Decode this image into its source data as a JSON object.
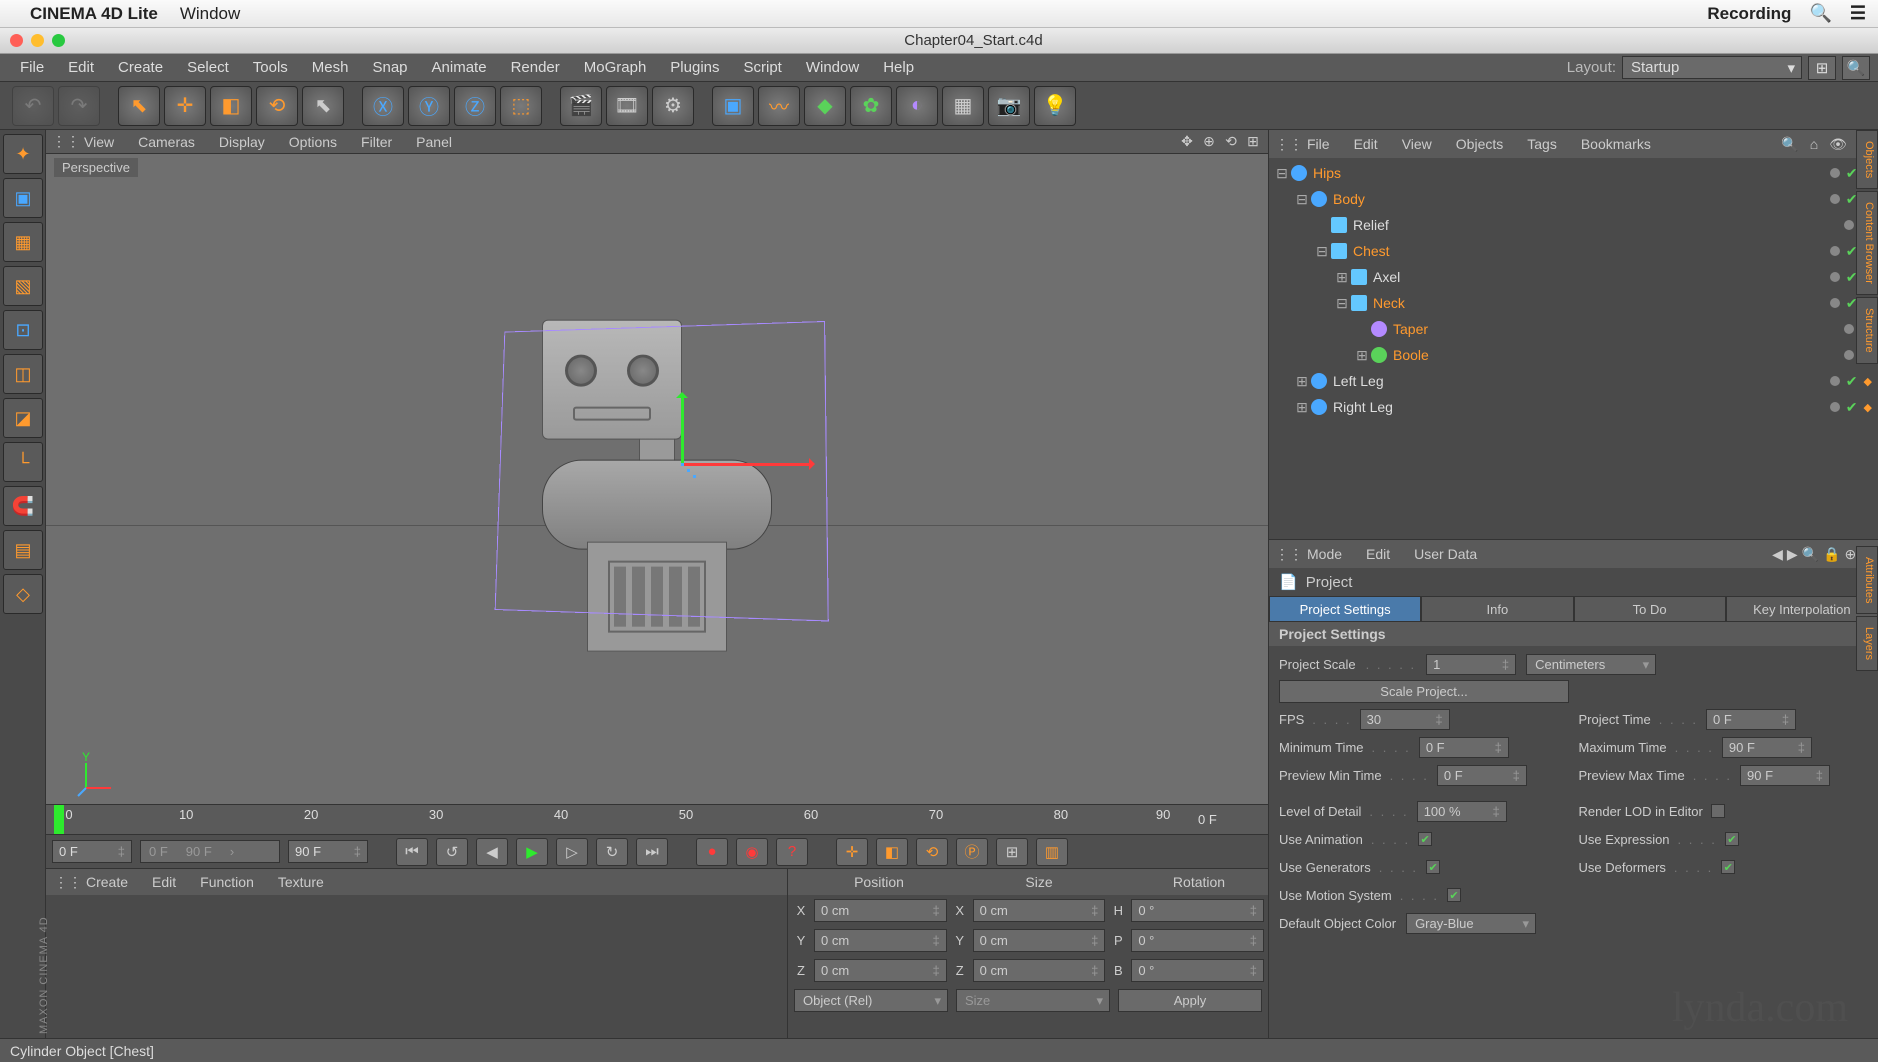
{
  "mac_menubar": {
    "app": "CINEMA 4D Lite",
    "items": [
      "Window"
    ],
    "right_status": "Recording"
  },
  "window": {
    "title": "Chapter04_Start.c4d"
  },
  "main_menu": {
    "items": [
      "File",
      "Edit",
      "Create",
      "Select",
      "Tools",
      "Mesh",
      "Snap",
      "Animate",
      "Render",
      "MoGraph",
      "Plugins",
      "Script",
      "Window",
      "Help"
    ],
    "layout_label": "Layout:",
    "layout_value": "Startup"
  },
  "viewport": {
    "menu": [
      "View",
      "Cameras",
      "Display",
      "Options",
      "Filter",
      "Panel"
    ],
    "label": "Perspective",
    "axis_y": "Y"
  },
  "object_manager": {
    "menu": [
      "File",
      "Edit",
      "View",
      "Objects",
      "Tags",
      "Bookmarks"
    ],
    "tree": [
      {
        "depth": 0,
        "expand": "⊟",
        "icon": "null",
        "name": "Hips",
        "hl": true,
        "tags": 2
      },
      {
        "depth": 1,
        "expand": "⊟",
        "icon": "null",
        "name": "Body",
        "hl": true,
        "tags": 2
      },
      {
        "depth": 2,
        "expand": "",
        "icon": "cube",
        "name": "Relief",
        "hl": false,
        "tags": 1
      },
      {
        "depth": 2,
        "expand": "⊟",
        "icon": "cyl",
        "name": "Chest",
        "hl": true,
        "tags": 2
      },
      {
        "depth": 3,
        "expand": "⊞",
        "icon": "cyl",
        "name": "Axel",
        "hl": false,
        "tags": 2
      },
      {
        "depth": 3,
        "expand": "⊟",
        "icon": "cyl",
        "name": "Neck",
        "hl": true,
        "tags": 2
      },
      {
        "depth": 4,
        "expand": "",
        "icon": "deform",
        "name": "Taper",
        "hl": true,
        "tags": 1
      },
      {
        "depth": 4,
        "expand": "⊞",
        "icon": "boole",
        "name": "Boole",
        "hl": true,
        "tags": 1
      },
      {
        "depth": 1,
        "expand": "⊞",
        "icon": "null",
        "name": "Left Leg",
        "hl": false,
        "tags": 2
      },
      {
        "depth": 1,
        "expand": "⊞",
        "icon": "null",
        "name": "Right Leg",
        "hl": false,
        "tags": 2
      }
    ]
  },
  "attribute_manager": {
    "menu": [
      "Mode",
      "Edit",
      "User Data"
    ],
    "title": "Project",
    "tabs": [
      "Project Settings",
      "Info",
      "To Do",
      "Key Interpolation"
    ],
    "section": "Project Settings",
    "project_scale_label": "Project Scale",
    "project_scale_value": "1",
    "project_scale_unit": "Centimeters",
    "scale_btn": "Scale Project...",
    "rows": [
      {
        "l1": "FPS",
        "v1": "30",
        "l2": "Project Time",
        "v2": "0 F"
      },
      {
        "l1": "Minimum Time",
        "v1": "0 F",
        "l2": "Maximum Time",
        "v2": "90 F"
      },
      {
        "l1": "Preview Min Time",
        "v1": "0 F",
        "l2": "Preview Max Time",
        "v2": "90 F"
      }
    ],
    "lod_label": "Level of Detail",
    "lod_value": "100 %",
    "render_lod_label": "Render LOD in Editor",
    "checks": [
      {
        "l1": "Use Animation",
        "l2": "Use Expression"
      },
      {
        "l1": "Use Generators",
        "l2": "Use Deformers"
      },
      {
        "l1": "Use Motion System",
        "l2": ""
      }
    ],
    "default_color_label": "Default Object Color",
    "default_color_value": "Gray-Blue"
  },
  "timeline": {
    "ticks": [
      "0",
      "10",
      "20",
      "30",
      "40",
      "50",
      "60",
      "70",
      "80",
      "90"
    ],
    "current": "0 F"
  },
  "transport": {
    "cur": "0 F",
    "range_a": "0 F",
    "range_b": "90 F",
    "end": "90 F"
  },
  "material_panel": {
    "menu": [
      "Create",
      "Edit",
      "Function",
      "Texture"
    ]
  },
  "coord_panel": {
    "headers": [
      "Position",
      "Size",
      "Rotation"
    ],
    "rows": [
      {
        "a": "X",
        "p": "0 cm",
        "s": "0 cm",
        "ra": "H",
        "r": "0 °"
      },
      {
        "a": "Y",
        "p": "0 cm",
        "s": "0 cm",
        "ra": "P",
        "r": "0 °"
      },
      {
        "a": "Z",
        "p": "0 cm",
        "s": "0 cm",
        "ra": "B",
        "r": "0 °"
      }
    ],
    "mode": "Object (Rel)",
    "size_mode": "Size",
    "apply": "Apply"
  },
  "side_tabs": [
    "Objects",
    "Content Browser",
    "Structure",
    "Attributes",
    "Layers"
  ],
  "status": "Cylinder Object [Chest]",
  "watermark": "lynda.com",
  "maxon": "MAXON CINEMA 4D"
}
